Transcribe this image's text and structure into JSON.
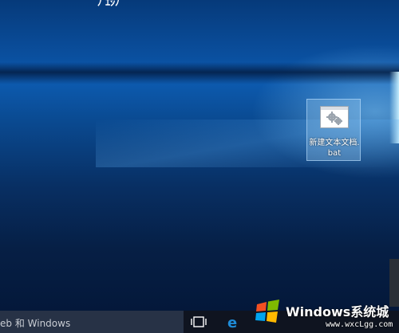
{
  "desktop": {
    "top_partial_text": "ﾉ ｴｼﾉ",
    "icon": {
      "name": "file-icon",
      "label": "新建文本文档.bat"
    }
  },
  "taskbar": {
    "search_placeholder": "eb 和 Windows",
    "taskview_icon": "task-view-icon",
    "edge_icon": "edge-browser-icon"
  },
  "watermark": {
    "title": "Windows系统城",
    "url": "www.wxcLgg.com",
    "logo_icon": "windows-logo-icon"
  },
  "colors": {
    "taskbar": "#0f1420",
    "search_box": "#273246",
    "edge_blue": "#1e8bd6"
  }
}
